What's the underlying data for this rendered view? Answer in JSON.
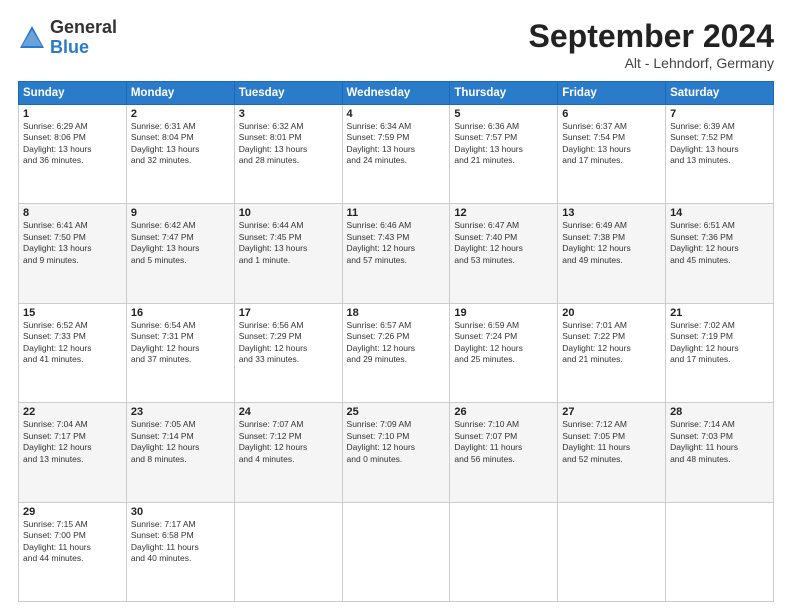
{
  "header": {
    "logo_general": "General",
    "logo_blue": "Blue",
    "month_title": "September 2024",
    "subtitle": "Alt - Lehndorf, Germany"
  },
  "columns": [
    "Sunday",
    "Monday",
    "Tuesday",
    "Wednesday",
    "Thursday",
    "Friday",
    "Saturday"
  ],
  "weeks": [
    [
      {
        "day": "1",
        "info": "Sunrise: 6:29 AM\nSunset: 8:06 PM\nDaylight: 13 hours\nand 36 minutes."
      },
      {
        "day": "2",
        "info": "Sunrise: 6:31 AM\nSunset: 8:04 PM\nDaylight: 13 hours\nand 32 minutes."
      },
      {
        "day": "3",
        "info": "Sunrise: 6:32 AM\nSunset: 8:01 PM\nDaylight: 13 hours\nand 28 minutes."
      },
      {
        "day": "4",
        "info": "Sunrise: 6:34 AM\nSunset: 7:59 PM\nDaylight: 13 hours\nand 24 minutes."
      },
      {
        "day": "5",
        "info": "Sunrise: 6:36 AM\nSunset: 7:57 PM\nDaylight: 13 hours\nand 21 minutes."
      },
      {
        "day": "6",
        "info": "Sunrise: 6:37 AM\nSunset: 7:54 PM\nDaylight: 13 hours\nand 17 minutes."
      },
      {
        "day": "7",
        "info": "Sunrise: 6:39 AM\nSunset: 7:52 PM\nDaylight: 13 hours\nand 13 minutes."
      }
    ],
    [
      {
        "day": "8",
        "info": "Sunrise: 6:41 AM\nSunset: 7:50 PM\nDaylight: 13 hours\nand 9 minutes."
      },
      {
        "day": "9",
        "info": "Sunrise: 6:42 AM\nSunset: 7:47 PM\nDaylight: 13 hours\nand 5 minutes."
      },
      {
        "day": "10",
        "info": "Sunrise: 6:44 AM\nSunset: 7:45 PM\nDaylight: 13 hours\nand 1 minute."
      },
      {
        "day": "11",
        "info": "Sunrise: 6:46 AM\nSunset: 7:43 PM\nDaylight: 12 hours\nand 57 minutes."
      },
      {
        "day": "12",
        "info": "Sunrise: 6:47 AM\nSunset: 7:40 PM\nDaylight: 12 hours\nand 53 minutes."
      },
      {
        "day": "13",
        "info": "Sunrise: 6:49 AM\nSunset: 7:38 PM\nDaylight: 12 hours\nand 49 minutes."
      },
      {
        "day": "14",
        "info": "Sunrise: 6:51 AM\nSunset: 7:36 PM\nDaylight: 12 hours\nand 45 minutes."
      }
    ],
    [
      {
        "day": "15",
        "info": "Sunrise: 6:52 AM\nSunset: 7:33 PM\nDaylight: 12 hours\nand 41 minutes."
      },
      {
        "day": "16",
        "info": "Sunrise: 6:54 AM\nSunset: 7:31 PM\nDaylight: 12 hours\nand 37 minutes."
      },
      {
        "day": "17",
        "info": "Sunrise: 6:56 AM\nSunset: 7:29 PM\nDaylight: 12 hours\nand 33 minutes."
      },
      {
        "day": "18",
        "info": "Sunrise: 6:57 AM\nSunset: 7:26 PM\nDaylight: 12 hours\nand 29 minutes."
      },
      {
        "day": "19",
        "info": "Sunrise: 6:59 AM\nSunset: 7:24 PM\nDaylight: 12 hours\nand 25 minutes."
      },
      {
        "day": "20",
        "info": "Sunrise: 7:01 AM\nSunset: 7:22 PM\nDaylight: 12 hours\nand 21 minutes."
      },
      {
        "day": "21",
        "info": "Sunrise: 7:02 AM\nSunset: 7:19 PM\nDaylight: 12 hours\nand 17 minutes."
      }
    ],
    [
      {
        "day": "22",
        "info": "Sunrise: 7:04 AM\nSunset: 7:17 PM\nDaylight: 12 hours\nand 13 minutes."
      },
      {
        "day": "23",
        "info": "Sunrise: 7:05 AM\nSunset: 7:14 PM\nDaylight: 12 hours\nand 8 minutes."
      },
      {
        "day": "24",
        "info": "Sunrise: 7:07 AM\nSunset: 7:12 PM\nDaylight: 12 hours\nand 4 minutes."
      },
      {
        "day": "25",
        "info": "Sunrise: 7:09 AM\nSunset: 7:10 PM\nDaylight: 12 hours\nand 0 minutes."
      },
      {
        "day": "26",
        "info": "Sunrise: 7:10 AM\nSunset: 7:07 PM\nDaylight: 11 hours\nand 56 minutes."
      },
      {
        "day": "27",
        "info": "Sunrise: 7:12 AM\nSunset: 7:05 PM\nDaylight: 11 hours\nand 52 minutes."
      },
      {
        "day": "28",
        "info": "Sunrise: 7:14 AM\nSunset: 7:03 PM\nDaylight: 11 hours\nand 48 minutes."
      }
    ],
    [
      {
        "day": "29",
        "info": "Sunrise: 7:15 AM\nSunset: 7:00 PM\nDaylight: 11 hours\nand 44 minutes."
      },
      {
        "day": "30",
        "info": "Sunrise: 7:17 AM\nSunset: 6:58 PM\nDaylight: 11 hours\nand 40 minutes."
      },
      {
        "day": "",
        "info": ""
      },
      {
        "day": "",
        "info": ""
      },
      {
        "day": "",
        "info": ""
      },
      {
        "day": "",
        "info": ""
      },
      {
        "day": "",
        "info": ""
      }
    ]
  ]
}
